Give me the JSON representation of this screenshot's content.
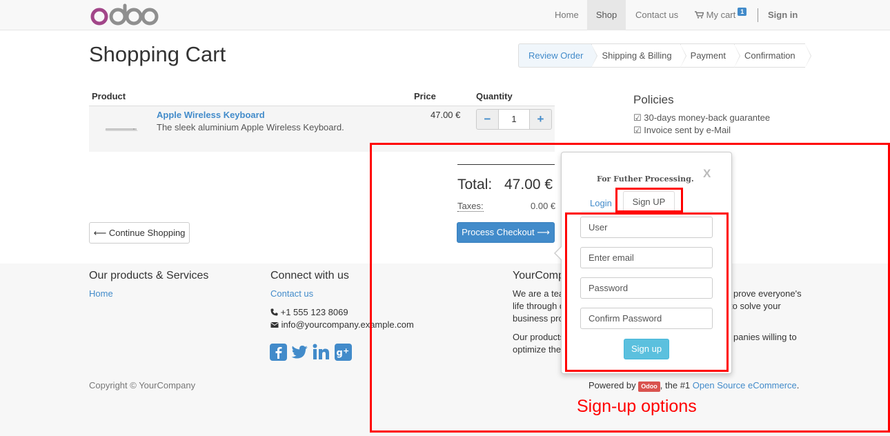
{
  "navbar": {
    "brand": "odoo",
    "items": [
      {
        "label": "Home"
      },
      {
        "label": "Shop"
      },
      {
        "label": "Contact us"
      },
      {
        "label": "My cart"
      }
    ],
    "cart_count": "1",
    "signin_label": "Sign in",
    "cart_icon": "shopping-cart-icon"
  },
  "page": {
    "title": "Shopping Cart"
  },
  "wizard": {
    "steps": [
      "Review Order",
      "Shipping & Billing",
      "Payment",
      "Confirmation"
    ],
    "active": "Review Order"
  },
  "cart": {
    "headers": {
      "product": "Product",
      "price": "Price",
      "quantity": "Quantity"
    },
    "item": {
      "name": "Apple Wireless Keyboard",
      "description": "The sleek aluminium Apple Wireless Keyboard.",
      "price": "47.00 €",
      "quantity": "1",
      "minus": "−",
      "plus": "+"
    },
    "total_label": "Total:",
    "total_value": "47.00 €",
    "taxes_label": "Taxes:",
    "taxes_value": "0.00 €",
    "continue_label": "⟵ Continue Shopping",
    "checkout_label": "Process Checkout ⟶"
  },
  "policies": {
    "title": "Policies",
    "items": [
      "☑ 30-days money-back guarantee",
      "☑ Invoice sent by e-Mail"
    ]
  },
  "popup": {
    "title": "For Futher Processing.",
    "close": "X",
    "tab_login": "Login",
    "tab_signup": "Sign UP",
    "fields": {
      "user": "User",
      "email": "Enter email",
      "password": "Password",
      "confirm": "Confirm Password"
    },
    "submit": "Sign up"
  },
  "footer": {
    "products_title": "Our products & Services",
    "products_link": "Home",
    "connect_title": "Connect with us",
    "contact_link": "Contact us",
    "phone": "+1 555 123 8069",
    "email": "info@yourcompany.example.com",
    "social_icons": [
      "facebook-icon",
      "twitter-icon",
      "linkedin-icon",
      "google-plus-icon"
    ],
    "company_title": "YourComp",
    "company_line1a": "We are a tea",
    "company_line1b": "prove everyone's",
    "company_line2a": "life through d",
    "company_line2b": "to solve your",
    "company_line3": "business pro",
    "company_line4a": "Our products",
    "company_line4b": "panies willing to",
    "company_line5": "optimize thei",
    "copyright": "Copyright © YourCompany",
    "powered_prefix": "Powered by",
    "powered_badge": "Odoo",
    "powered_middle": ", the #1",
    "powered_link": "Open Source eCommerce",
    "powered_suffix": "."
  },
  "annotation": {
    "label": "Sign-up options",
    "color": "#ff0000"
  },
  "colors": {
    "brand_purple": "#875a7b",
    "link_blue": "#428bca",
    "info_button": "#5bc0de"
  }
}
